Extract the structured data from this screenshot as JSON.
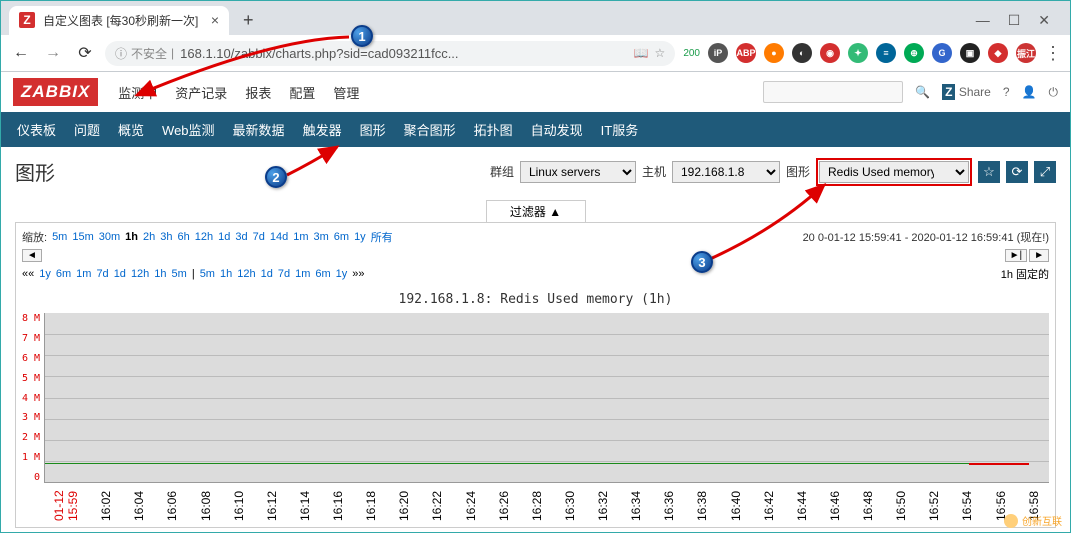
{
  "browser": {
    "tab_title": "自定义图表 [每30秒刷新一次]",
    "tab_favicon_letter": "Z",
    "new_tab": "+",
    "win_min": "—",
    "win_max": "☐",
    "win_close": "✕",
    "back": "←",
    "forward": "→",
    "reload": "⟳",
    "insecure": "不安全",
    "url_prefix": "168.1.10/zabbix/charts.php?sid=cad093211fcc...",
    "star": "☆",
    "ext_badge": "200",
    "menu_dots": "⋮",
    "avatar_label": "振江"
  },
  "zabbix": {
    "logo": "ZABBIX",
    "top_nav": [
      "监测中",
      "资产记录",
      "报表",
      "配置",
      "管理"
    ],
    "share": "Share",
    "share_prefix": "Z",
    "sub_nav": [
      "仪表板",
      "问题",
      "概览",
      "Web监测",
      "最新数据",
      "触发器",
      "图形",
      "聚合图形",
      "拓扑图",
      "自动发现",
      "IT服务"
    ],
    "page_title": "图形",
    "group_label": "群组",
    "group_value": "Linux servers",
    "host_label": "主机",
    "host_value": "192.168.1.8",
    "graph_label": "图形",
    "graph_value": "Redis Used memory",
    "filter_toggle": "过滤器 ▲",
    "zoom_label": "缩放:",
    "zoom_links": [
      "5m",
      "15m",
      "30m",
      "1h",
      "2h",
      "3h",
      "6h",
      "12h",
      "1d",
      "3d",
      "7d",
      "14d",
      "1m",
      "3m",
      "6m",
      "1y",
      "所有"
    ],
    "zoom_active": "1h",
    "time_range": "20  0-01-12 15:59:41 - 2020-01-12 16:59:41 (现在!)",
    "nav_left_outer": "|◄",
    "nav_left": "◄",
    "nav_right": "►",
    "nav_right_outer": "►|",
    "bottom_left_prefix": "««",
    "bottom_left_links": [
      "1y",
      "6m",
      "1m",
      "7d",
      "1d",
      "12h",
      "1h",
      "5m"
    ],
    "bottom_right_links": [
      "5m",
      "1h",
      "12h",
      "1d",
      "7d",
      "1m",
      "6m",
      "1y"
    ],
    "bottom_right_suffix": "»»",
    "fixed_label": "1h  固定的",
    "star_icon": "☆",
    "refresh_icon": "⟳",
    "expand_icon": "⤢"
  },
  "chart_data": {
    "type": "line",
    "title": "192.168.1.8: Redis Used memory (1h)",
    "ylabel": "M",
    "ylim": [
      0,
      8
    ],
    "y_ticks": [
      "8 M",
      "7 M",
      "6 M",
      "5 M",
      "4 M",
      "3 M",
      "2 M",
      "1 M",
      "0"
    ],
    "x_start_label": "01-12 15:59",
    "x": [
      "16:02",
      "16:04",
      "16:06",
      "16:08",
      "16:10",
      "16:12",
      "16:14",
      "16:16",
      "16:18",
      "16:20",
      "16:22",
      "16:24",
      "16:26",
      "16:28",
      "16:30",
      "16:32",
      "16:34",
      "16:36",
      "16:38",
      "16:40",
      "16:42",
      "16:44",
      "16:46",
      "16:48",
      "16:50",
      "16:52",
      "16:54",
      "16:56",
      "16:58"
    ],
    "series": [
      {
        "name": "Redis Used memory",
        "values_approx_M": 0.9
      }
    ]
  },
  "annotations": {
    "b1": "1",
    "b2": "2",
    "b3": "3"
  },
  "watermark": "创新互联"
}
